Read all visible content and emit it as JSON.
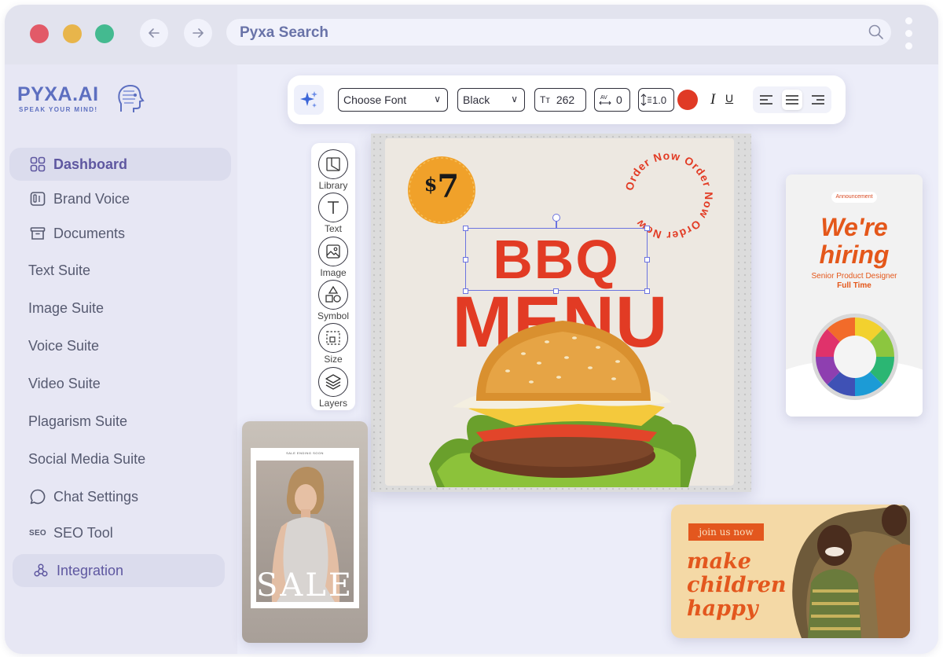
{
  "browser": {
    "title": "Pyxa Search",
    "traffic_lights": [
      "#e25a68",
      "#e8b54b",
      "#44ba90"
    ]
  },
  "logo": {
    "name": "PYXA.AI",
    "tagline": "SPEAK YOUR MIND!"
  },
  "sidebar": {
    "items": [
      {
        "label": "Dashboard",
        "icon": "grid-icon"
      },
      {
        "label": "Brand Voice",
        "icon": "brand-voice-icon"
      },
      {
        "label": "Documents",
        "icon": "archive-icon"
      },
      {
        "label": "Text Suite"
      },
      {
        "label": "Image Suite"
      },
      {
        "label": "Voice Suite"
      },
      {
        "label": "Video Suite"
      },
      {
        "label": "Plagarism Suite"
      },
      {
        "label": "Social Media Suite"
      },
      {
        "label": "Chat Settings",
        "icon": "chat-icon"
      },
      {
        "label": "SEO Tool",
        "icon_text": "SEO"
      },
      {
        "label": "Integration",
        "icon": "integration-icon"
      }
    ]
  },
  "toolbar": {
    "font": "Choose Font",
    "color_name": "Black",
    "text_size": "262",
    "letter_spacing": "0",
    "line_height": "1.0",
    "text_size_icon": "Tт",
    "selected_color": "#e03a25",
    "italic": "I",
    "underline": "U",
    "alignment": "center"
  },
  "tools": [
    "Library",
    "Text",
    "Image",
    "Symbol",
    "Size",
    "Layers"
  ],
  "design": {
    "price": "7",
    "price_symbol": "$",
    "ring_text": "Order Now Order Now Order Now",
    "title1": "BBQ",
    "title2": "MENU"
  },
  "templates": {
    "hiring": {
      "badge": "Announcement",
      "line1": "We're",
      "line2": "hiring",
      "role": "Senior Product Designer",
      "type": "Full Time"
    },
    "sale": {
      "top": "SALE ENDING SOON",
      "word": "SALE"
    },
    "join": {
      "tag": "join us now",
      "line1": "make",
      "line2": "children",
      "line3": "happy"
    }
  }
}
